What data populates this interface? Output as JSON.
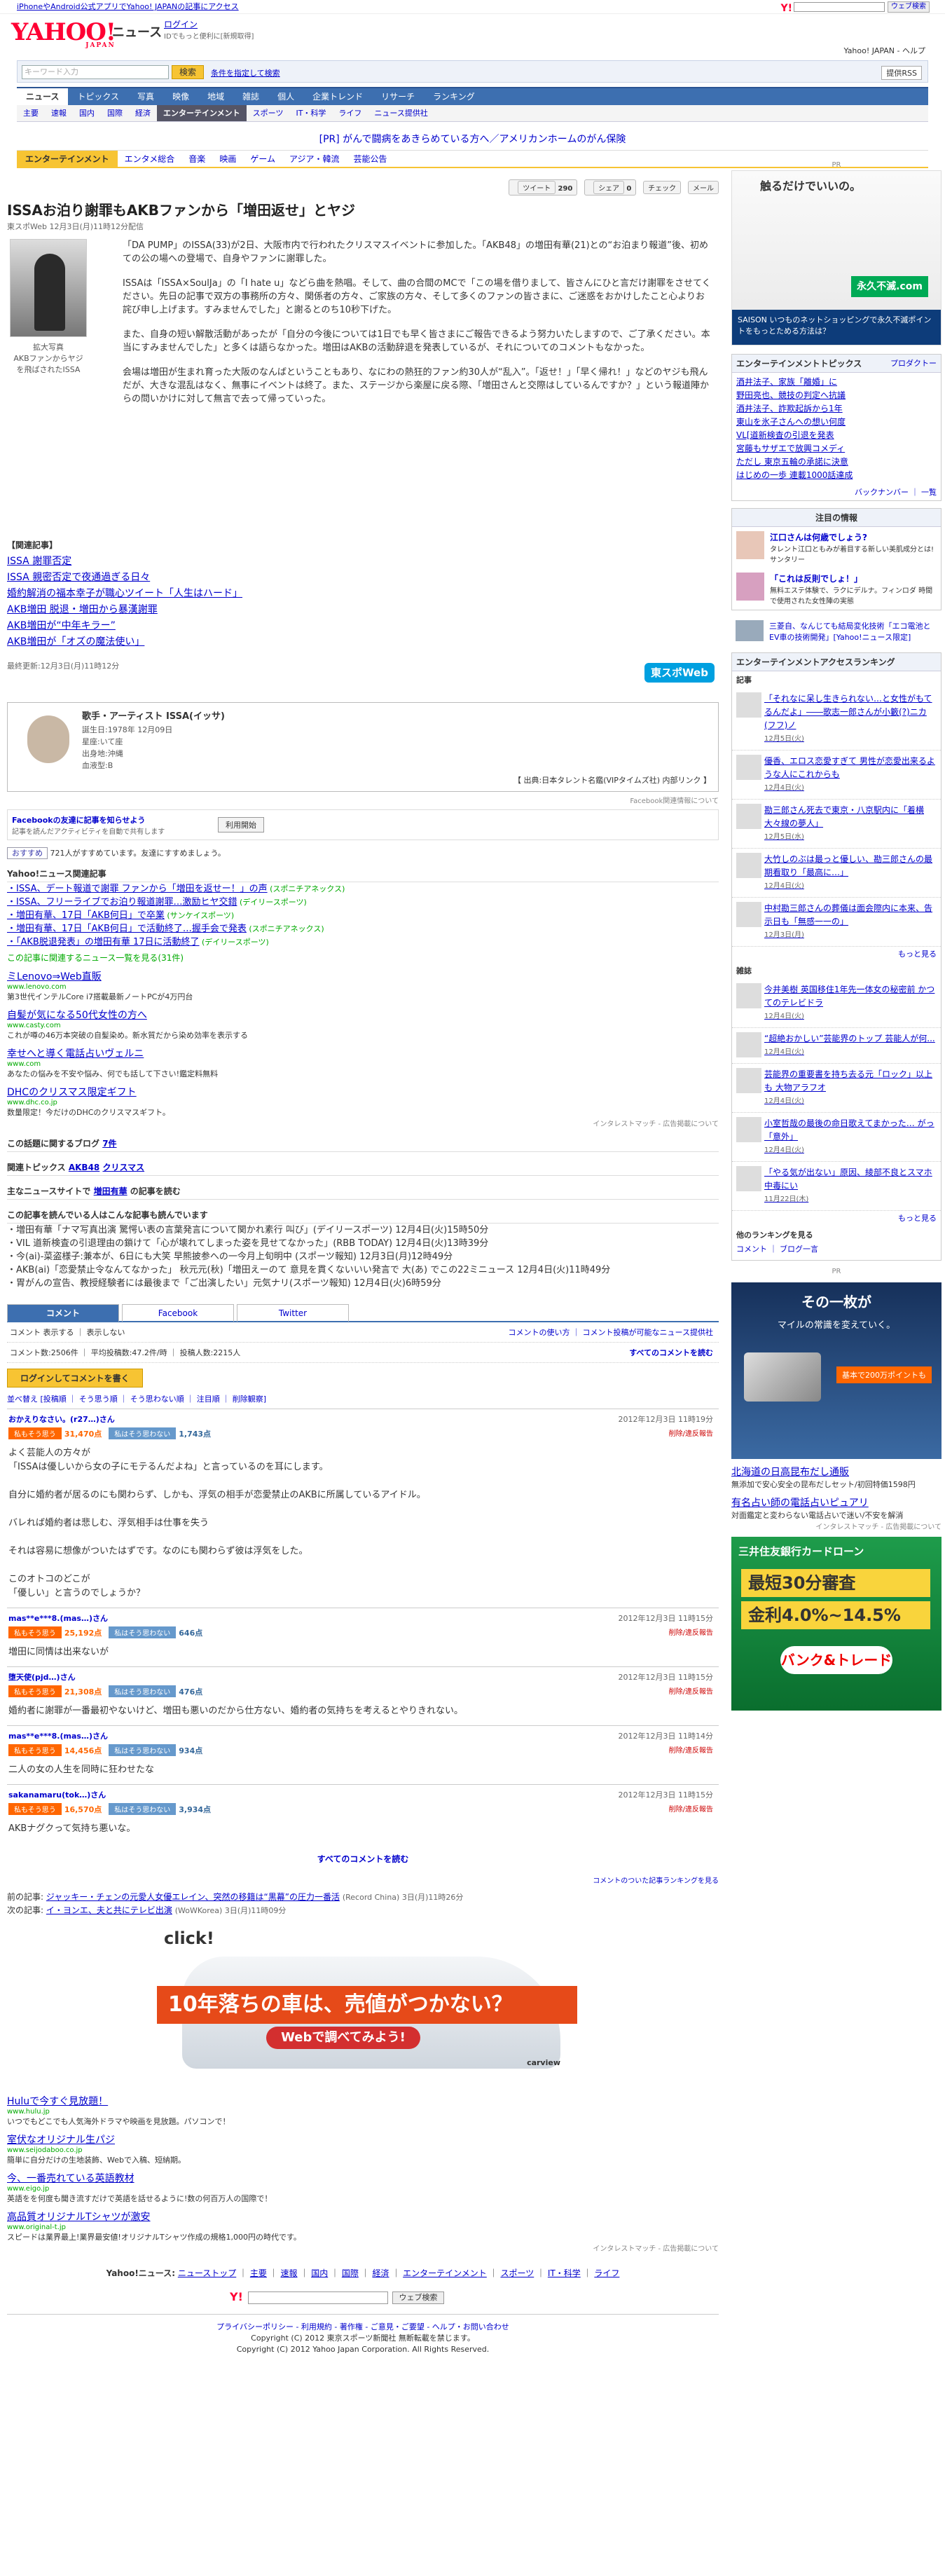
{
  "topbar": {
    "note": "iPhoneやAndroid公式アプリでYahoo! JAPANの記事にアクセス",
    "search_button": "ウェブ検索"
  },
  "header": {
    "logo": "YAHOO!",
    "logo_sub": "JAPAN",
    "service": "ニュース",
    "login": "ログイン",
    "login_sub": "IDでもっと便利に[新規取得]",
    "links": "Yahoo! JAPAN - ヘルプ"
  },
  "search": {
    "placeholder": "キーワード入力",
    "button": "検索",
    "condition": "条件を指定して検索",
    "help": "提供RSS"
  },
  "nav_main": [
    {
      "label": "ニュース",
      "on": true
    },
    {
      "label": "トピックス"
    },
    {
      "label": "写真"
    },
    {
      "label": "映像"
    },
    {
      "label": "地域"
    },
    {
      "label": "雑誌"
    },
    {
      "label": "個人"
    },
    {
      "label": "企業トレンド"
    },
    {
      "label": "リサーチ"
    },
    {
      "label": "ランキング"
    }
  ],
  "nav_sub": [
    {
      "label": "主要"
    },
    {
      "label": "速報"
    },
    {
      "label": "国内"
    },
    {
      "label": "国際"
    },
    {
      "label": "経済"
    },
    {
      "label": "エンターテインメント",
      "on": true
    },
    {
      "label": "スポーツ"
    },
    {
      "label": "IT・科学"
    },
    {
      "label": "ライフ"
    },
    {
      "label": "ニュース提供社"
    }
  ],
  "pr_line": "[PR] がんで闘病をあきらめている方へ／アメリカンホームのがん保険",
  "cat_nav": {
    "category": "エンターテインメント",
    "items": [
      "エンタメ総合",
      "音楽",
      "映画",
      "ゲーム",
      "アジア・韓流",
      "芸能公告"
    ]
  },
  "share": {
    "tweet": "ツイート",
    "tweet_count": "290",
    "fb": "シェア",
    "fb_count": "0",
    "check": "チェック",
    "mail": "メール"
  },
  "article": {
    "title": "ISSAお泊り謝罪もAKBファンから「増田返せ」とヤジ",
    "source": "東スポWeb 12月3日(月)11時12分配信",
    "photo_caption": "拡大写真\nAKBファンからヤジを飛ばされたISSA",
    "paragraphs": [
      "「DA PUMP」のISSA(33)が2日、大阪市内で行われたクリスマスイベントに参加した。「AKB48」の増田有華(21)との“お泊まり報道”後、初めての公の場への登場で、自身やファンに謝罪した。",
      "ISSAは「ISSA×SoulJa」の「I hate u」などら曲を熱唱。そして、曲の合間のMCで「この場を借りまして、皆さんにひと言だけ謝罪をさせてください。先日の記事で双方の事務所の方々、関係者の方々、ご家族の方々、そして多くのファンの皆さまに、ご迷惑をおかけしたこと心よりお詫び申し上げます。すみませんでした」と謝るとのち10秒下げた。",
      "また、自身の短い解散活動があったが「自分の今後については1日でも早く皆さまにご報告できるよう努力いたしますので、ご了承ください。本当にすみませんでした」と多くは語らなかった。増田はAKBの活動辞退を発表しているが、それについてのコメントもなかった。",
      "会場は増田が生まれ育った大阪のなんばということもあり、なにわの熱狂的ファン約30人が“乱入”。「返せ！」「早く帰れ！」などのヤジも飛んだが、大きな混乱はなく、無事にイベントは終了。また、ステージから楽屋に戻る際、「増田さんと交際はしているんですか？」という報道陣からの問いかけに対して無言で去って帰っていった。"
    ],
    "related_title": "【関連記事】",
    "related": [
      "ISSA 謝罪否定",
      "ISSA 親密否定で夜通過ぎる日々",
      "婚約解消の福本幸子が職心ツイート「人生はハード」",
      "AKB増田 脱退・増田から暴漢謝罪",
      "AKB増田が“中年キラー”",
      "AKB増田が「オズの魔法使い」"
    ],
    "updated": "最終更新:12月3日(月)11時12分",
    "tospo": "東スポWeb"
  },
  "artist": {
    "name": "歌手・アーティスト ISSA(イッサ)",
    "details": "誕生日:1978年 12月09日\n星座:いて座\n出身地:沖縄\n血液型:B",
    "credit": "【 出典:日本タレント名鑑(VIPタイムズ社) 内部リンク 】"
  },
  "fb": {
    "link": "Facebook関連情報について",
    "friends": "Facebookの友達に記事を知らせよう",
    "sub": "記事を読んだアクティビティを自動で共有します",
    "btn": "利用開始",
    "like": "おすすめ",
    "like_count": "721人がすすめています。友達にすすめましょう。"
  },
  "news_related": {
    "title": "Yahoo!ニュース関連記事",
    "items": [
      {
        "t": "ISSA、デート報道で謝罪 ファンから「増田を返せー！」の声",
        "p": "(スポニチアネックス)"
      },
      {
        "t": "ISSA、フリーライブでお泊り報道謝罪…激励ヒヤ交錯",
        "p": "(デイリースポーツ)"
      },
      {
        "t": "増田有華、17日「AKB何日」で卒業",
        "p": "(サンケイスポーツ)"
      },
      {
        "t": "増田有華、17日「AKB何日」で活動終了…握手会で発表",
        "p": "(スポニチアネックス)"
      },
      {
        "t": "「AKB脱退発表」の増田有華 17日に活動終了",
        "p": "(デイリースポーツ)"
      }
    ],
    "more": "この記事に関連するニュース一覧を見る(31件)"
  },
  "ads1": [
    {
      "t": "ミLenovo⇒Web直販",
      "u": "www.lenovo.com",
      "d": "第3世代インテルCore i7搭載最新ノートPCが4万円台"
    },
    {
      "t": "自髪が気になる50代女性の方へ",
      "u": "www.casty.com",
      "d": "これが噂の46万本突破の自髪染め。新水質だから染め効率を表示する"
    },
    {
      "t": "幸せへと導く電話占いヴェルニ",
      "u": "www.com",
      "d": "あなたの悩みを不安や悩み、何でも話して下さい!鑑定料無料"
    },
    {
      "t": "DHCのクリスマス限定ギフト",
      "u": "www.dhc.co.jp",
      "d": "数量限定！今だけのDHCのクリスマスギフト。"
    }
  ],
  "ads_footer": "インタレストマッチ - 広告掲載について",
  "blog": {
    "title": "この話題に関するブログ",
    "count": "7件"
  },
  "topics": {
    "label": "関連トピックス",
    "items": [
      "AKB48",
      "クリスマス"
    ]
  },
  "main_news": {
    "label": "主なニュースサイトで",
    "name": "増田有華",
    "tail": "の記事を読む"
  },
  "readers": {
    "title": "この記事を読んでいる人はこんな記事も読んでいます",
    "items": [
      "増田有華「ナマ写真出演 驚愕い表の言葉発言について関かれ素行 叫び」(デイリースポーツ) 12月4日(火)15時50分",
      "VIL 道新検査の引退理由の鎖けて「心が壊れてしまった姿を見せてなかった」(RBB TODAY) 12月4日(火)13時39分",
      "今(ai)-菜盗様子:兼本が、6日にも大笑 早熊披参への一今月上旬明中 (スポーツ報知) 12月3日(月)12時49分",
      "AKB(ai)「恋愛禁止令なんてなかった」 秋元元(秋)「増田えーのて 意見を貫くないいい発言で 大(あ) でこの22ミニュース 12月4日(火)11時49分",
      "胃がんの宣告、教授経験者には最後まで「ご出演したい」元気ナリ(スポーツ報知) 12月4日(火)6時59分"
    ]
  },
  "comments": {
    "tabs": [
      "コメント",
      "Facebook",
      "Twitter"
    ],
    "bar": "コメント 表示する ｜ 表示しない",
    "bar_right": "コメントの使い方 ｜ コメント投稿が可能なニュース提供社",
    "stats": "コメント数:2506件 ｜ 平均投稿数:47.2件/時 ｜ 投稿人数:2215人",
    "read_all": "すべてのコメントを読む",
    "login_btn": "ログインしてコメントを書く",
    "sort": "並べ替え [投稿順 ｜ そう思う順 ｜ そう思わない順 ｜ 注目順 ｜ 削除観察]",
    "items": [
      {
        "name": "おかえりなさい。(r27…)さん",
        "time": "2012年12月3日 11時19分",
        "good": "31,470点",
        "bad": "1,743点",
        "body": "よく芸能人の方々が\n「ISSAは優しいから女の子にモテるんだよね」と言っているのを耳にします。\n\n自分に婚約者が居るのにも関わらず、しかも、浮気の相手が恋愛禁止のAKBに所属しているアイドル。\n\nバレれば婚約者は悲しむ、浮気相手は仕事を失う\n\nそれは容易に想像がついたはずです。なのにも関わらず彼は浮気をした。\n\nこのオトコのどこが\n「優しい」と言うのでしょうか？"
      },
      {
        "name": "mas**e***8.(mas…)さん",
        "time": "2012年12月3日 11時15分",
        "good": "25,192点",
        "bad": "646点",
        "body": "増田に同情は出来ないが"
      },
      {
        "name": "堕天使(pjd…)さん",
        "time": "2012年12月3日 11時15分",
        "good": "21,308点",
        "bad": "476点",
        "body": "婚約者に謝罪が一番最初やないけど、増田も悪いのだから仕方ない、婚約者の気持ちを考えるとやりきれない。"
      },
      {
        "name": "mas**e***8.(mas…)さん",
        "time": "2012年12月3日 11時14分",
        "good": "14,456点",
        "bad": "934点",
        "body": "二人の女の人生を同時に狂わせたな"
      },
      {
        "name": "sakanamaru(tok…)さん",
        "time": "2012年12月3日 11時15分",
        "good": "16,570点",
        "bad": "3,934点",
        "body": "AKBナグクって気持ち悪いな。"
      }
    ],
    "good_label": "私もそう思う",
    "bad_label": "私はそう思わない",
    "report": "削除/違反報告",
    "all": "すべてのコメントを読む",
    "stats_link": "コメントのついた記事ランキングを見る"
  },
  "prevnext": {
    "prev_label": "前の記事:",
    "prev": "ジャッキー・チェンの元愛人女優エレイン、突然の移籍は“黒幕”の圧力一番活",
    "prev_src": "(Record China) 3日(月)11時26分",
    "next_label": "次の記事:",
    "next": "イ・ヨンエ、夫と共にテレビ出演",
    "next_src": "(WoWKorea) 3日(月)11時09分"
  },
  "car_ad": {
    "click": "click!",
    "text": "10年落ちの車は、売値がつかない？",
    "btn": "Webで調べてみよう!",
    "brand": "carview"
  },
  "ads2": [
    {
      "t": "Huluで今すぐ見放題！",
      "u": "www.hulu.jp",
      "d": "いつでもどこでも人気海外ドラマや映画を見放題。パソコンで！"
    },
    {
      "t": "室伏なオリジナル生パジ",
      "u": "www.seijodaboo.co.jp",
      "d": "簡単に自分だけの生地装飾、Webで入稿、短納期。"
    },
    {
      "t": "今、一番売れている英語教材",
      "u": "www.eigo.jp",
      "d": "英語をを何度も聞き流すだけで英語を話せるように!数の何百万人の国際で！"
    },
    {
      "t": "高品質オリジナルTシャツが激安",
      "u": "www.original-t.jp",
      "d": "スピードは業界最上!業界最安値!オリジナルTシャツ作成の規格1,000円の時代です。"
    }
  ],
  "footer": {
    "nav_label": "Yahoo!ニュース:",
    "nav": [
      "ニューストップ",
      "主要",
      "速報",
      "国内",
      "国際",
      "経済",
      "エンターテインメント",
      "スポーツ",
      "IT・科学",
      "ライフ"
    ],
    "btn": "ウェブ検索",
    "links": "プライバシーポリシー ‐ 利用規約 ‐ 著作権 ‐ ご意見・ご要望 ‐ ヘルプ・お問い合わせ",
    "copy1": "Copyright (C) 2012 東京スポーツ新聞社 無断転載を禁じます。",
    "copy2": "Copyright (C) 2012 Yahoo Japan Corporation. All Rights Reserved."
  },
  "side": {
    "pr": "PR",
    "ad1_title": "触るだけでいいの。",
    "ad1_logo": "永久不滅.com",
    "ad1_bar": "SAISON いつものネットショッピングで永久不滅ポイントをもっとためる方法は？",
    "topics_title": "エンターテインメントトピックス",
    "topics_more": "プロダクトー",
    "topics": [
      "酒井法子、家族「離婚」に",
      "野田亮也、競技の判定へ抗議",
      "酒井法子、詐欺起訴から1年",
      "東山を氷子さんへの想い何度",
      "VL[道新検査の引退を発表",
      "宮藤もサザエで放興コメディ",
      "ただし 東京五輪の承諾に決意",
      "はじめの一歩 連載1000話達成"
    ],
    "topics_foot": "バックナンバー ｜ 一覧",
    "info_title": "注目の情報",
    "info": [
      "江口さんは何歳でしょう?",
      "「これは反則でしょ！」"
    ],
    "info_sub": [
      "タレント江口ともみが着目する新しい美肌成分とは! サンタリー",
      "無料エステ体験で、ラクにデルナ。フィンロダ 時間で使用された女性陣の実態"
    ],
    "pr_line": "三菱自、なんじても結局変化技術「エコ電池とEV車の技術開発」[Yahoo!ニュース限定]",
    "access_title": "エンターテインメントアクセスランキング",
    "access_sub": "記事",
    "access": [
      {
        "t": "「それなに呆し生きられない…と女性がもてるんだよ」――歌志一郎さんが小籔(?)ニカ(フフ)ノ",
        "tm": "12月5日(火)"
      },
      {
        "t": "優香、エロス恋愛すぎて 男性が恋愛出来るような人にこれからも",
        "tm": "12月4日(火)"
      },
      {
        "t": "勘三郎さん死去で東京・八京駅内に「着横大々線の夢人」",
        "tm": "12月5日(水)"
      },
      {
        "t": "大竹しのぶは最っと優しい、勘三郎さんの最期看取り「最高に…」",
        "tm": "12月4日(火)"
      },
      {
        "t": "中村勘三郎さんの葬儀は面会際内に本来、告示日も「無感一一の」",
        "tm": "12月3日(月)"
      }
    ],
    "access_more": "もっと見る",
    "mag_sub": "雑誌",
    "mag": [
      {
        "t": "今井美樹 英国移住1年先一体女の秘密前 かつてのテレビドラ",
        "tm": "12月4日(火)"
      },
      {
        "t": "“超絶おかしい”芸能界のトップ 芸能人が何...",
        "tm": "12月4日(火)"
      },
      {
        "t": "芸能界の重要書を持ち去る元「ロック」以上も 大物アラフオ",
        "tm": "12月4日(火)"
      },
      {
        "t": "小室哲哉の最後の命日歌えてまかった… がっ「意外」",
        "tm": "12月4日(火)"
      },
      {
        "t": "「やる気が出ない」原因、綾部不良とスマホ中毒にい",
        "tm": "11月22日(木)"
      }
    ],
    "mag_more": "もっと見る",
    "other_title": "他のランキングを見る",
    "other": [
      "コメント",
      "ブログ一言"
    ],
    "card_title": "その一枚が",
    "card_sub": "マイルの常識を変えていく。",
    "card_pts": "基本で200万ポイントも",
    "ad3": [
      {
        "t": "北海道の日高昆布だし通販",
        "d": "無添加で安心安全の昆布だしセット/初回特価1598円"
      },
      {
        "t": "有名占い師の電話占いピュアリ",
        "d": "対面鑑定と変わらない電話占いで迷い/不安を解消"
      }
    ],
    "bank_title": "三井住友銀行カードローン",
    "bank_r1": "最短30分審査",
    "bank_r2": "金利4.0%~14.5%",
    "bank_btn": "バンク&トレード"
  }
}
